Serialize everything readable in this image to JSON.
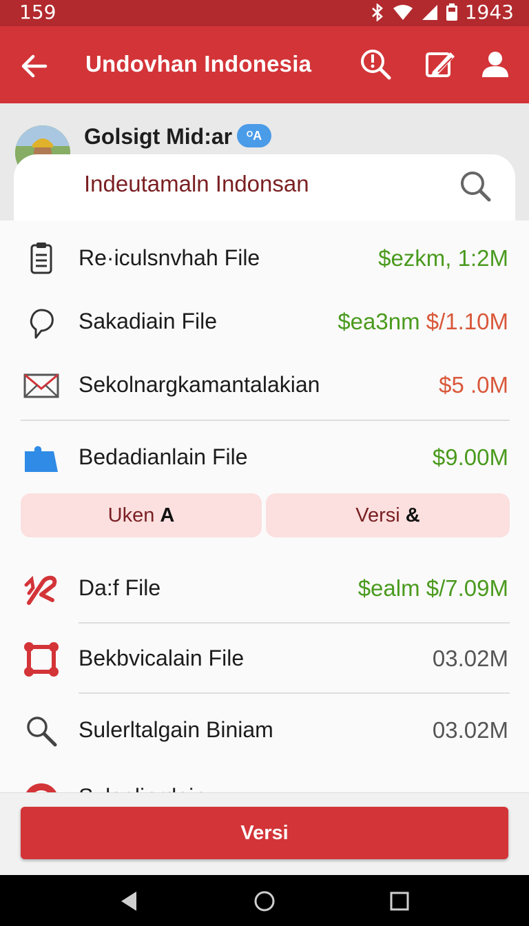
{
  "status": {
    "time": "159",
    "clock": "1943"
  },
  "appbar": {
    "title": "Undovhan Indonesia"
  },
  "profile": {
    "name": "Golsigt Mid:ar",
    "badge": "ᴼA"
  },
  "search": {
    "text": "Indeutamaln Indonsan"
  },
  "colors": {
    "primary": "#d33438",
    "green": "#4a9a1e",
    "orange": "#d9573a",
    "gray": "#555555"
  },
  "files": [
    {
      "label": "Re·iculsnvhah File",
      "value": "$ezkm, 1:2M",
      "color": "green",
      "icon": "clipboard-icon"
    },
    {
      "label": "Sakadiain File",
      "value_green": "$ea3nm",
      "value_orange": "$/1.10M",
      "icon": "chat-bubble-icon"
    },
    {
      "label": "Sekolnargkamantalakian",
      "value": "$5 .0M",
      "color": "orange",
      "icon": "envelope-icon"
    },
    {
      "label": "Bedadianlain File",
      "value": "$9.00M",
      "color": "green",
      "icon": "puzzle-icon"
    },
    {
      "label": "Da:f File",
      "value": "$ealm $/7.09M",
      "color": "green",
      "icon": "scribble-icon"
    },
    {
      "label": "Bekbvicalain File",
      "value": "03.02M",
      "color": "gray",
      "icon": "nodes-icon"
    },
    {
      "label": "Sulerltalgain Biniam",
      "value": "03.02M",
      "color": "gray",
      "icon": "search-icon"
    },
    {
      "label": "Sulealinrdain",
      "icon": "circle-icon"
    }
  ],
  "chips": {
    "left": "Uken",
    "left_strong": "A",
    "right": "Versi",
    "right_strong": "&"
  },
  "bottom": {
    "button": "Versi"
  }
}
